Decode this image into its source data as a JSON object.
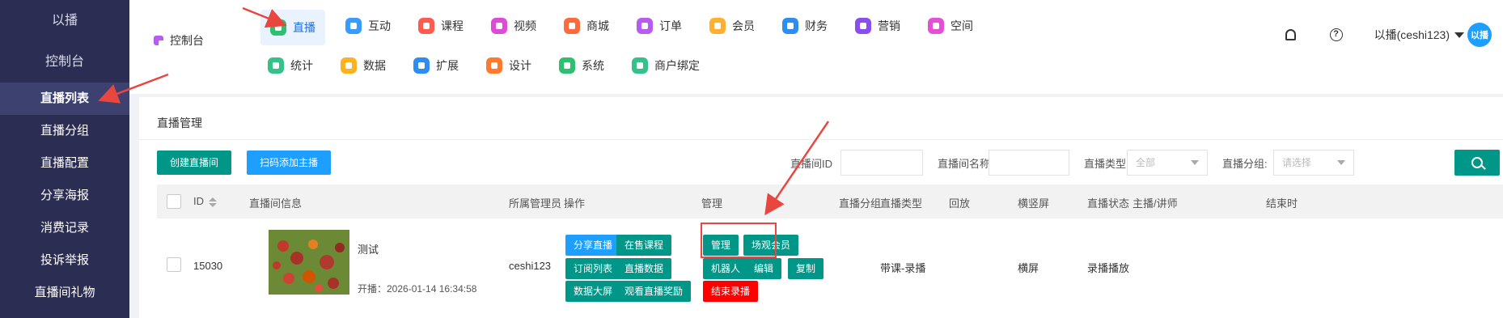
{
  "sidebar": {
    "logo": "以播",
    "console": "控制台",
    "items": [
      {
        "label": "直播列表",
        "active": true
      },
      {
        "label": "直播分组"
      },
      {
        "label": "直播配置"
      },
      {
        "label": "分享海报"
      },
      {
        "label": "消费记录"
      },
      {
        "label": "投诉举报"
      },
      {
        "label": "直播间礼物"
      }
    ]
  },
  "topbar": {
    "crumb": "控制台",
    "nav_row1": [
      {
        "label": "直播",
        "color": "#2fbf71",
        "active": true
      },
      {
        "label": "互动",
        "color": "#3a9bff"
      },
      {
        "label": "课程",
        "color": "#ff5a4e"
      },
      {
        "label": "视频",
        "color": "#e04ad8"
      },
      {
        "label": "商城",
        "color": "#ff6a3d"
      },
      {
        "label": "订单",
        "color": "#b85cf0"
      },
      {
        "label": "会员",
        "color": "#ffb02e"
      },
      {
        "label": "财务",
        "color": "#2f8df0"
      },
      {
        "label": "营销",
        "color": "#8a4df0"
      },
      {
        "label": "空间",
        "color": "#e44fd6"
      }
    ],
    "nav_row2": [
      {
        "label": "统计",
        "color": "#35c28a"
      },
      {
        "label": "数据",
        "color": "#ffb21f"
      },
      {
        "label": "扩展",
        "color": "#2f8df0"
      },
      {
        "label": "设计",
        "color": "#ff7a2e"
      },
      {
        "label": "系统",
        "color": "#2fbf71"
      },
      {
        "label": "商户绑定",
        "color": "#35c28a"
      }
    ],
    "user_name": "以播(ceshi123)",
    "avatar_text": "以播"
  },
  "main": {
    "title": "直播管理",
    "create_button": "创建直播间",
    "scan_button": "扫码添加主播",
    "filters": {
      "id_label": "直播间ID",
      "name_label": "直播间名称",
      "type_label": "直播类型",
      "type_value": "全部",
      "group_label": "直播分组:",
      "group_placeholder": "请选择"
    },
    "table": {
      "headers": {
        "id": "ID",
        "info": "直播间信息",
        "admin": "所属管理员",
        "ops": "操作",
        "manage": "管理",
        "group": "直播分组",
        "type": "直播类型",
        "replay": "回放",
        "screen": "横竖屏",
        "status": "直播状态",
        "host": "主播/讲师",
        "end": "结束时"
      },
      "rows": [
        {
          "id": "15030",
          "name": "测试",
          "start": "开播：2026-01-14 16:34:58",
          "admin": "ceshi123",
          "ops": [
            "分享直播",
            "在售课程",
            "订阅列表",
            "直播数据",
            "数据大屏",
            "观看直播奖励"
          ],
          "manage": [
            "管理",
            "场观会员",
            "机器人",
            "编辑",
            "复制",
            "结束录播"
          ],
          "type": "带课-录播",
          "screen": "横屏",
          "status": "录播播放"
        }
      ]
    }
  }
}
